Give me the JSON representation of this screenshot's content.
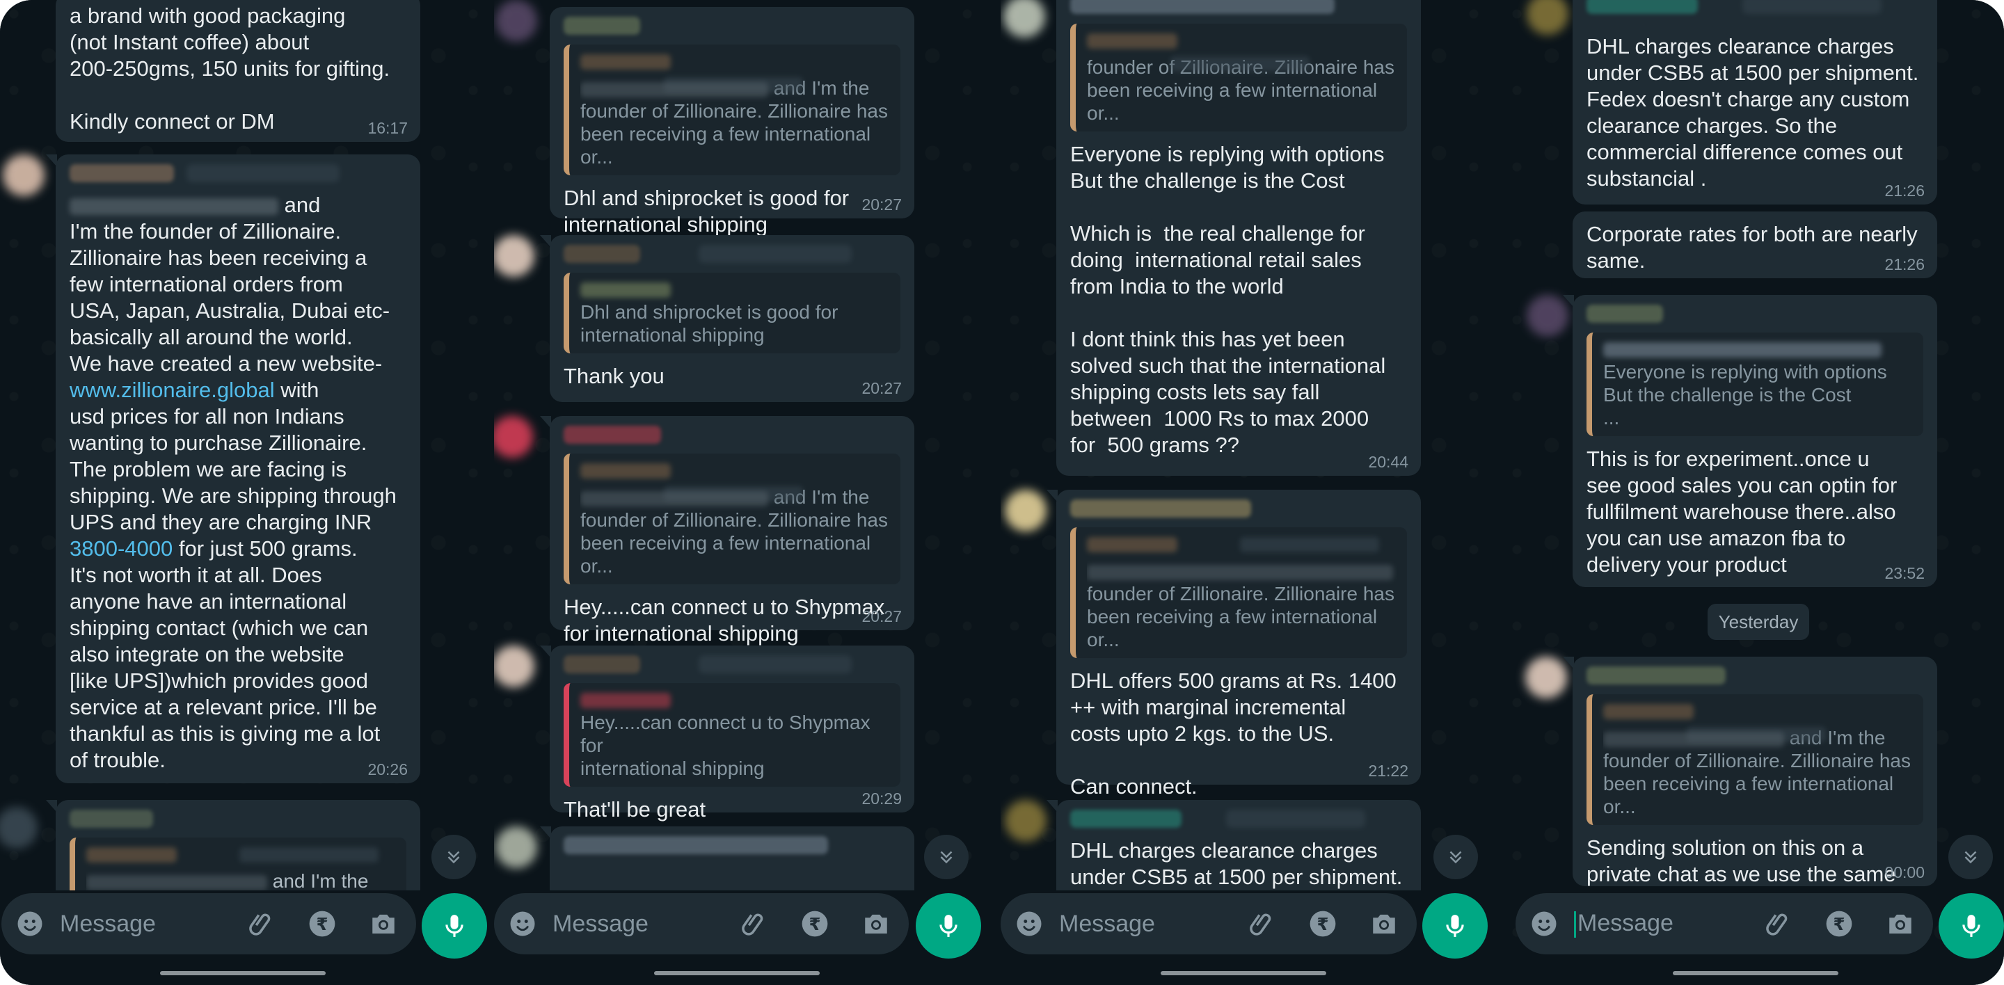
{
  "colors": {
    "background": "#0b141a",
    "bubble": "#1f2c34",
    "accent": "#00a884",
    "link": "#53bdeb",
    "muted": "#8696a0"
  },
  "composer": {
    "placeholder": "Message"
  },
  "icons": [
    "emoji-icon",
    "attach-icon",
    "rupee-icon",
    "camera-icon",
    "mic-icon",
    "scroll-down-icon"
  ],
  "date_separator": "Yesterday",
  "p1": {
    "m1": {
      "text": "a brand with good packaging\n(not Instant coffee) about\n200-250gms, 150 units for gifting.\n\nKindly connect or DM",
      "time": "16:17"
    },
    "m2": {
      "intro": "and",
      "text_a": "I'm the founder of Zillionaire.\nZillionaire has been receiving a\nfew international orders from\nUSA, Japan, Australia, Dubai etc-\nbasically all around the world.\nWe have created a new website-\n",
      "link1": "www.zillionaire.global",
      "text_b": " with\nusd prices for all non Indians\nwanting to purchase Zillionaire.\nThe problem we are facing is\nshipping. We are shipping through\nUPS and they are charging INR\n",
      "link2": "3800-4000",
      "text_c": " for just 500 grams.\nIt's not worth it at all. Does\nanyone have an international\nshipping contact (which we can\nalso integrate on the website\n[like UPS])which provides good\nservice at a relevant price. I'll be\nthankful as this is giving me a lot\nof trouble.",
      "time": "20:26"
    },
    "m3": {
      "quote": "and I'm the"
    }
  },
  "p2": {
    "m1": {
      "quote_tail": "and I'm the",
      "quote": "founder of Zillionaire. Zillionaire has\nbeen receiving a few international or...",
      "text": "Dhl and shiprocket is good for\ninternational shipping",
      "time": "20:27"
    },
    "m2": {
      "quote": "Dhl and shiprocket is good for\ninternational shipping",
      "text": "Thank you",
      "time": "20:27"
    },
    "m3": {
      "quote_tail": "and I'm the",
      "quote": "founder of Zillionaire. Zillionaire has\nbeen receiving a few international or...",
      "text": "Hey.....can connect u to Shypmax\nfor international shipping",
      "time": "20:27"
    },
    "m4": {
      "quote": "Hey.....can connect u to Shypmax for\ninternational shipping",
      "text": "That'll be great",
      "time": "20:29"
    }
  },
  "p3": {
    "m1": {
      "quote": "founder of Zillionaire. Zillionaire has\nbeen receiving a few international or...",
      "text": "Everyone is replying with options\nBut the challenge is the Cost\n\nWhich is  the real challenge for\ndoing  international retail sales\nfrom India to the world\n\nI dont think this has yet been\nsolved such that the international\nshipping costs lets say fall\nbetween  1000 Rs to max 2000\nfor  500 grams ??",
      "time": "20:44"
    },
    "m2": {
      "quote": "founder of Zillionaire. Zillionaire has\nbeen receiving a few international or...",
      "text": "DHL offers 500 grams at Rs. 1400\n++ with marginal incremental\ncosts upto 2 kgs. to the US.\n\nCan connect.",
      "time": "21:22"
    },
    "m3": {
      "text": "DHL charges clearance charges\nunder CSB5 at 1500 per shipment."
    }
  },
  "p4": {
    "m1": {
      "text": "DHL charges clearance charges\nunder CSB5 at 1500 per shipment.\nFedex doesn't charge any custom\nclearance charges. So the\ncommercial difference comes out\nsubstancial .",
      "time": "21:26"
    },
    "m2": {
      "text": "Corporate rates for both are nearly\nsame.",
      "time": "21:26"
    },
    "m3": {
      "quote": "Everyone is replying with options\nBut the challenge is the Cost\n...",
      "text": "This is for experiment..once u\nsee good sales you can optin for\nfullfilment warehouse there..also\nyou can use amazon fba to\ndelivery your product",
      "time": "23:52"
    },
    "m4": {
      "quote_tail": "and I'm the",
      "quote": "founder of Zillionaire. Zillionaire has\nbeen receiving a few international or...",
      "text": "Sending solution on this on a\nprivate chat as we use the same\nfor international shipping.",
      "time": "00:00"
    }
  }
}
